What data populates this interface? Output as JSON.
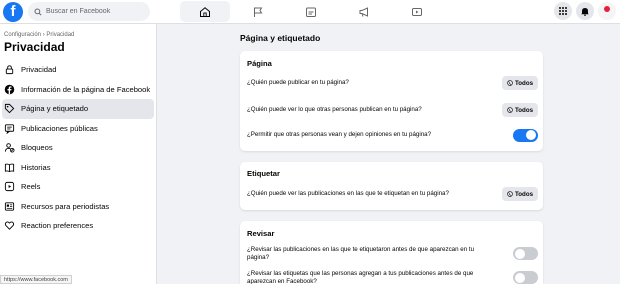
{
  "search": {
    "placeholder": "Buscar en Facebook"
  },
  "logo": "f",
  "sidebar": {
    "breadcrumb": "Configuración › Privacidad",
    "title": "Privacidad",
    "items": [
      {
        "label": "Privacidad",
        "icon": "lock-icon"
      },
      {
        "label": "Información de la página de Facebook",
        "icon": "facebook-icon"
      },
      {
        "label": "Página y etiquetado",
        "icon": "tag-icon"
      },
      {
        "label": "Publicaciones públicas",
        "icon": "public-posts-icon"
      },
      {
        "label": "Bloqueos",
        "icon": "block-user-icon"
      },
      {
        "label": "Historias",
        "icon": "book-icon"
      },
      {
        "label": "Reels",
        "icon": "reels-icon"
      },
      {
        "label": "Recursos para periodistas",
        "icon": "news-icon"
      },
      {
        "label": "Reaction preferences",
        "icon": "reaction-icon"
      }
    ]
  },
  "status_url": "https://www.facebook.com",
  "main": {
    "title": "Página y etiquetado",
    "sections": [
      {
        "title": "Página",
        "rows": [
          {
            "question": "¿Quién puede publicar en tu página?",
            "control": "button",
            "value": "Todos"
          },
          {
            "question": "¿Quién puede ver lo que otras personas publican en tu página?",
            "control": "button",
            "value": "Todos"
          },
          {
            "question": "¿Permitir que otras personas vean y dejen opiniones en tu página?",
            "control": "toggle",
            "on": true
          }
        ]
      },
      {
        "title": "Etiquetar",
        "rows": [
          {
            "question": "¿Quién puede ver las publicaciones en las que te etiquetan en tu página?",
            "control": "button",
            "value": "Todos"
          }
        ]
      },
      {
        "title": "Revisar",
        "rows": [
          {
            "question": "¿Revisar las publicaciones en las que te etiquetaron antes de que aparezcan en tu página?",
            "control": "toggle",
            "on": false
          },
          {
            "question": "¿Revisar las etiquetas que las personas agregan a tus publicaciones antes de que aparezcan en Facebook?",
            "control": "toggle",
            "on": false
          }
        ]
      }
    ]
  },
  "colors": {
    "accent": "#1877f2",
    "background": "#f0f2f5",
    "toggle_off": "#c9ccd1"
  }
}
